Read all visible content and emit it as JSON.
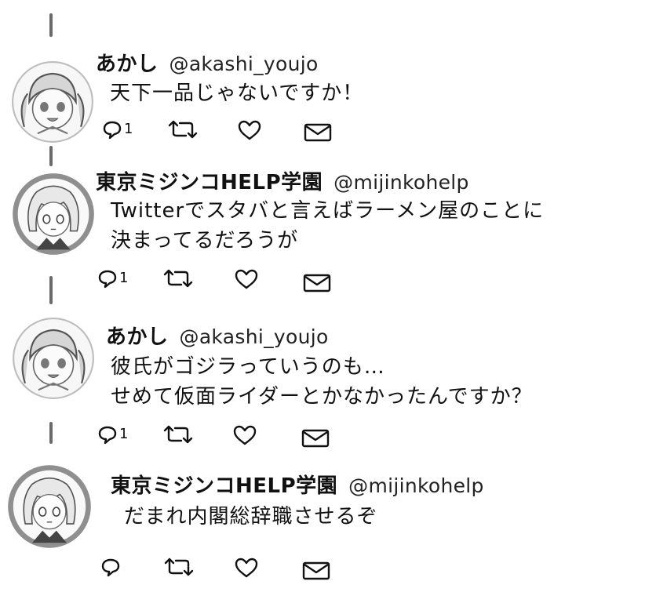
{
  "tweets": [
    {
      "author": "あかし",
      "handle": "@akashi_youjo",
      "text": "天下一品じゃないですか！",
      "reply_count": "1",
      "avatar": "twin-tail-girl-avatar"
    },
    {
      "author": "東京ミジンコHELP学園",
      "handle": "@mijinkohelp",
      "text": "Twitterでスタバと言えばラーメン屋のことに\n決まってるだろうが",
      "reply_count": "1",
      "avatar": "bob-hair-girl-avatar"
    },
    {
      "author": "あかし",
      "handle": "@akashi_youjo",
      "text": "彼氏がゴジラっていうのも…\nせめて仮面ライダーとかなかったんですか？",
      "reply_count": "1",
      "avatar": "twin-tail-girl-avatar"
    },
    {
      "author": "東京ミジンコHELP学園",
      "handle": "@mijinkohelp",
      "text": "だまれ内閣総辞職させるぞ",
      "reply_count": "",
      "avatar": "bob-hair-girl-avatar"
    }
  ],
  "icons": [
    "reply-icon",
    "retweet-icon",
    "like-icon",
    "message-icon"
  ]
}
